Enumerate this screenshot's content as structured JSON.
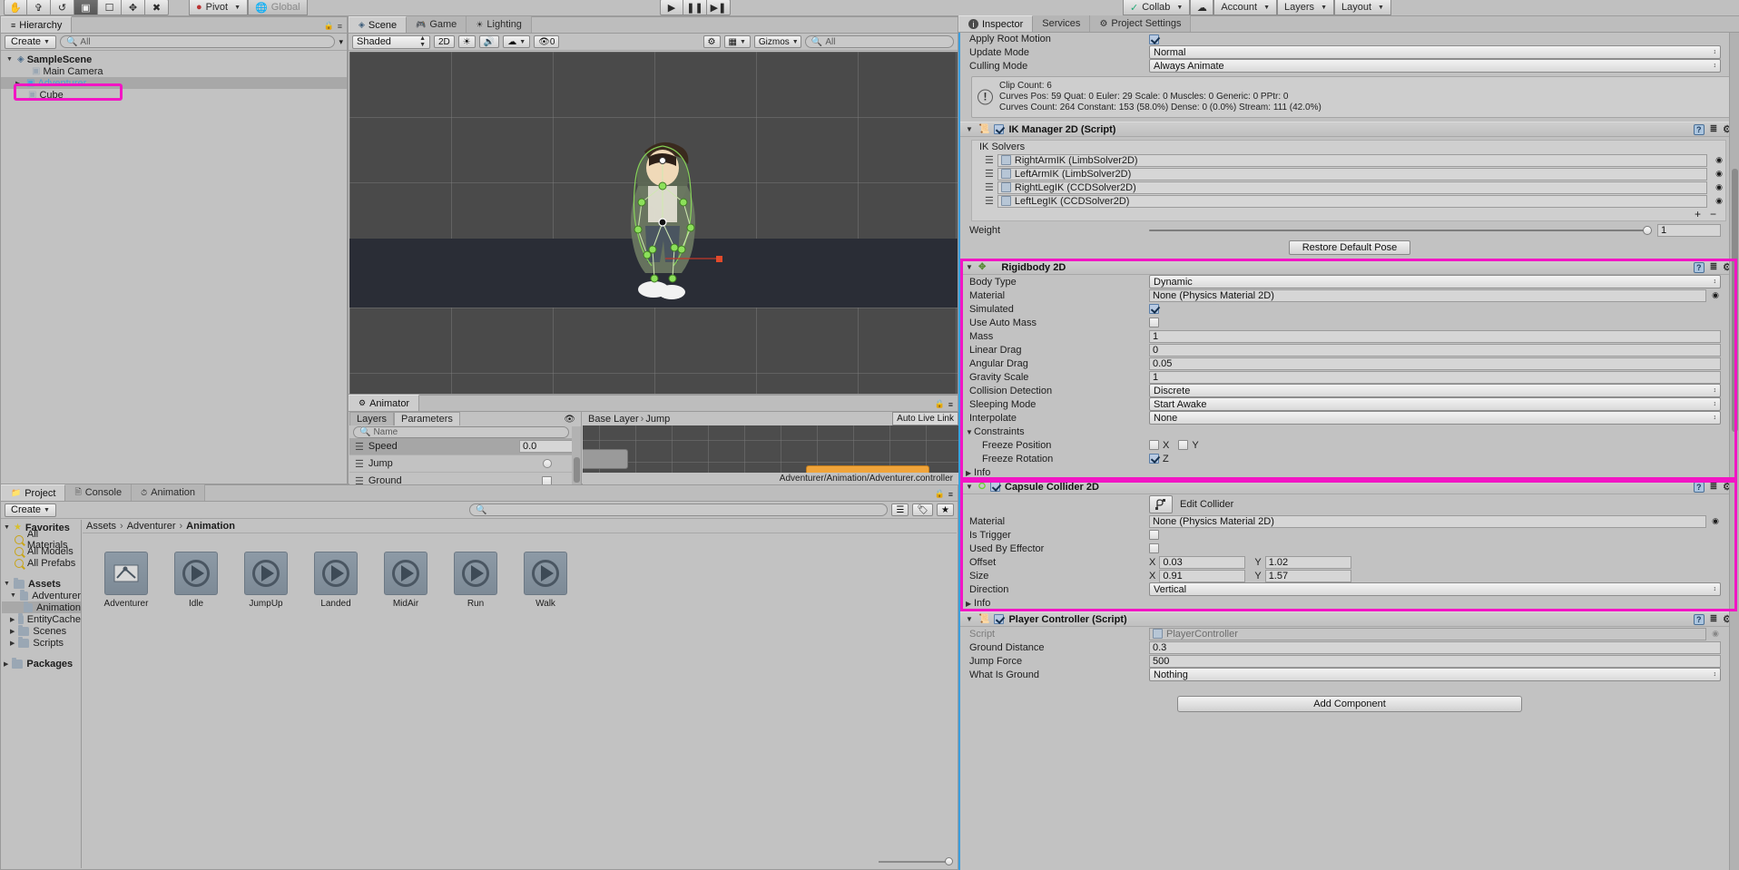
{
  "toolbar": {
    "tools": [
      "hand-tool",
      "move-tool",
      "rotate-tool",
      "scale-tool",
      "rect-tool",
      "transform-tool",
      "custom-tool"
    ],
    "pivot_label": "Pivot",
    "global_label": "Global",
    "play_label": "▶",
    "pause_label": "❙❙",
    "step_label": "▶❙",
    "collab_label": "Collab",
    "cloud_label": "☁",
    "account_label": "Account",
    "layers_label": "Layers",
    "layout_label": "Layout"
  },
  "hierarchy": {
    "tab": "Hierarchy",
    "create_label": "Create",
    "search_placeholder": "All",
    "items": [
      {
        "label": "SampleScene",
        "depth": 0,
        "arrow": "▼",
        "icon": "scene-icon",
        "bold": true,
        "state": "normal"
      },
      {
        "label": "Main Camera",
        "depth": 1,
        "arrow": "",
        "icon": "cube-icon",
        "bold": false,
        "state": "normal"
      },
      {
        "label": "Adventurer",
        "depth": 1,
        "arrow": "▶",
        "icon": "prefab-icon",
        "bold": false,
        "state": "prefab-selected"
      },
      {
        "label": "Cube",
        "depth": 2,
        "arrow": "",
        "icon": "cube-icon",
        "bold": false,
        "state": "highlighted"
      }
    ]
  },
  "scene": {
    "tabs": [
      {
        "label": "Scene",
        "icon": "scene-icon",
        "active": true
      },
      {
        "label": "Game",
        "icon": "game-icon",
        "active": false
      },
      {
        "label": "Lighting",
        "icon": "lighting-icon",
        "active": false
      }
    ],
    "shading_mode": "Shaded",
    "mode_2d": "2D",
    "gizmos_label": "Gizmos",
    "gizmos_search_placeholder": "All",
    "audio_icon": "audio-icon",
    "lighting_icon": "light-icon",
    "fx_icon": "fx-icon",
    "layers_count": "0",
    "camera_icon": "camera-icon"
  },
  "animator": {
    "tab": "Animator",
    "sub_tabs": [
      {
        "label": "Layers",
        "active": false
      },
      {
        "label": "Parameters",
        "active": true
      }
    ],
    "eye_icon": "eye-icon",
    "search_placeholder": "Name",
    "add_label": "+",
    "parameters": [
      {
        "name": "Speed",
        "type": "float",
        "value": "0.0",
        "selected": true
      },
      {
        "name": "Jump",
        "type": "trigger",
        "value": "",
        "selected": false
      },
      {
        "name": "Ground",
        "type": "bool",
        "value": "",
        "selected": false
      }
    ],
    "breadcrumbs": [
      "Base Layer",
      "Jump"
    ],
    "auto_live_link": "Auto Live Link",
    "status_path": "Adventurer/Animation/Adventurer.controller"
  },
  "project": {
    "tabs": [
      {
        "label": "Project",
        "icon": "project-icon",
        "active": true
      },
      {
        "label": "Console",
        "icon": "console-icon",
        "active": false
      },
      {
        "label": "Animation",
        "icon": "animation-icon",
        "active": false
      }
    ],
    "create_label": "Create",
    "search_placeholder": "",
    "tree": [
      {
        "label": "Favorites",
        "depth": 0,
        "arrow": "▼",
        "icon": "star-icon",
        "bold": true
      },
      {
        "label": "All Materials",
        "depth": 1,
        "arrow": "",
        "icon": "search-icon",
        "bold": false
      },
      {
        "label": "All Models",
        "depth": 1,
        "arrow": "",
        "icon": "search-icon",
        "bold": false
      },
      {
        "label": "All Prefabs",
        "depth": 1,
        "arrow": "",
        "icon": "search-icon",
        "bold": false
      },
      {
        "label": "Assets",
        "depth": 0,
        "arrow": "▼",
        "icon": "folder-icon",
        "bold": true
      },
      {
        "label": "Adventurer",
        "depth": 1,
        "arrow": "▼",
        "icon": "folder-icon",
        "bold": false
      },
      {
        "label": "Animation",
        "depth": 2,
        "arrow": "",
        "icon": "folder-icon",
        "bold": false,
        "selected": true
      },
      {
        "label": "EntityCache",
        "depth": 1,
        "arrow": "▶",
        "icon": "folder-icon",
        "bold": false
      },
      {
        "label": "Scenes",
        "depth": 1,
        "arrow": "▶",
        "icon": "folder-icon",
        "bold": false
      },
      {
        "label": "Scripts",
        "depth": 1,
        "arrow": "▶",
        "icon": "folder-icon",
        "bold": false
      },
      {
        "label": "Packages",
        "depth": 0,
        "arrow": "▶",
        "icon": "folder-icon",
        "bold": true
      }
    ],
    "breadcrumbs": [
      "Assets",
      "Adventurer",
      "Animation"
    ],
    "assets": [
      {
        "name": "Adventurer",
        "icon": "animator-controller-icon"
      },
      {
        "name": "Idle",
        "icon": "animation-clip-icon"
      },
      {
        "name": "JumpUp",
        "icon": "animation-clip-icon"
      },
      {
        "name": "Landed",
        "icon": "animation-clip-icon"
      },
      {
        "name": "MidAir",
        "icon": "animation-clip-icon"
      },
      {
        "name": "Run",
        "icon": "animation-clip-icon"
      },
      {
        "name": "Walk",
        "icon": "animation-clip-icon"
      }
    ],
    "zoom_slider": "asset-size-slider"
  },
  "inspector": {
    "tabs": [
      {
        "label": "Inspector",
        "icon": "info-icon",
        "active": true
      },
      {
        "label": "Services",
        "icon": "services-icon",
        "active": false
      },
      {
        "label": "Project Settings",
        "icon": "settings-icon",
        "active": false
      }
    ],
    "animator_section": {
      "rows": [
        {
          "label": "Apply Root Motion",
          "type": "checkbox",
          "value": true
        },
        {
          "label": "Update Mode",
          "type": "popup",
          "value": "Normal"
        },
        {
          "label": "Culling Mode",
          "type": "popup",
          "value": "Always Animate"
        }
      ],
      "info_lines": [
        "Clip Count: 6",
        "Curves Pos: 59 Quat: 0 Euler: 29 Scale: 0 Muscles: 0 Generic: 0 PPtr: 0",
        "Curves Count: 264 Constant: 153 (58.0%) Dense: 0 (0.0%) Stream: 111 (42.0%)"
      ]
    },
    "ik_manager": {
      "title": "IK Manager 2D (Script)",
      "enabled": true,
      "list_header": "IK Solvers",
      "solvers": [
        "RightArmIK (LimbSolver2D)",
        "LeftArmIK (LimbSolver2D)",
        "RightLegIK (CCDSolver2D)",
        "LeftLegIK (CCDSolver2D)"
      ],
      "add_label": "+",
      "remove_label": "−",
      "weight_label": "Weight",
      "weight_value": "1",
      "restore_button": "Restore Default Pose"
    },
    "rigidbody2d": {
      "title": "Rigidbody 2D",
      "highlighted": true,
      "rows": [
        {
          "label": "Body Type",
          "type": "popup",
          "value": "Dynamic"
        },
        {
          "label": "Material",
          "type": "objectfield",
          "value": "None (Physics Material 2D)"
        },
        {
          "label": "Simulated",
          "type": "checkbox",
          "value": true
        },
        {
          "label": "Use Auto Mass",
          "type": "checkbox",
          "value": false
        },
        {
          "label": "Mass",
          "type": "text",
          "value": "1"
        },
        {
          "label": "Linear Drag",
          "type": "text",
          "value": "0"
        },
        {
          "label": "Angular Drag",
          "type": "text",
          "value": "0.05"
        },
        {
          "label": "Gravity Scale",
          "type": "text",
          "value": "1"
        },
        {
          "label": "Collision Detection",
          "type": "popup",
          "value": "Discrete"
        },
        {
          "label": "Sleeping Mode",
          "type": "popup",
          "value": "Start Awake"
        },
        {
          "label": "Interpolate",
          "type": "popup",
          "value": "None"
        }
      ],
      "constraints_label": "Constraints",
      "freeze_position_label": "Freeze Position",
      "freeze_position_x": {
        "label": "X",
        "value": false
      },
      "freeze_position_y": {
        "label": "Y",
        "value": false
      },
      "freeze_rotation_label": "Freeze Rotation",
      "freeze_rotation_z": {
        "label": "Z",
        "value": true
      },
      "info_label": "Info"
    },
    "capsule_collider2d": {
      "title": "Capsule Collider 2D",
      "enabled": true,
      "highlighted": true,
      "edit_collider_label": "Edit Collider",
      "rows": [
        {
          "label": "Material",
          "type": "objectfield",
          "value": "None (Physics Material 2D)"
        },
        {
          "label": "Is Trigger",
          "type": "checkbox",
          "value": false
        },
        {
          "label": "Used By Effector",
          "type": "checkbox",
          "value": false
        }
      ],
      "offset": {
        "label": "Offset",
        "x_label": "X",
        "x": "0.03",
        "y_label": "Y",
        "y": "1.02"
      },
      "size": {
        "label": "Size",
        "x_label": "X",
        "x": "0.91",
        "y_label": "Y",
        "y": "1.57"
      },
      "direction": {
        "label": "Direction",
        "value": "Vertical"
      },
      "info_label": "Info"
    },
    "player_controller": {
      "title": "Player Controller (Script)",
      "enabled": true,
      "rows": [
        {
          "label": "Script",
          "type": "script",
          "value": "PlayerController"
        },
        {
          "label": "Ground Distance",
          "type": "text",
          "value": "0.3"
        },
        {
          "label": "Jump Force",
          "type": "text",
          "value": "500"
        },
        {
          "label": "What Is Ground",
          "type": "popup",
          "value": "Nothing"
        }
      ]
    },
    "add_component_label": "Add Component"
  },
  "colors": {
    "highlight": "#f215c4",
    "accent": "#3b9ede",
    "panel": "#c2c2c2",
    "scene_bg": "#4a4a4a",
    "ground": "#2a2d36"
  }
}
